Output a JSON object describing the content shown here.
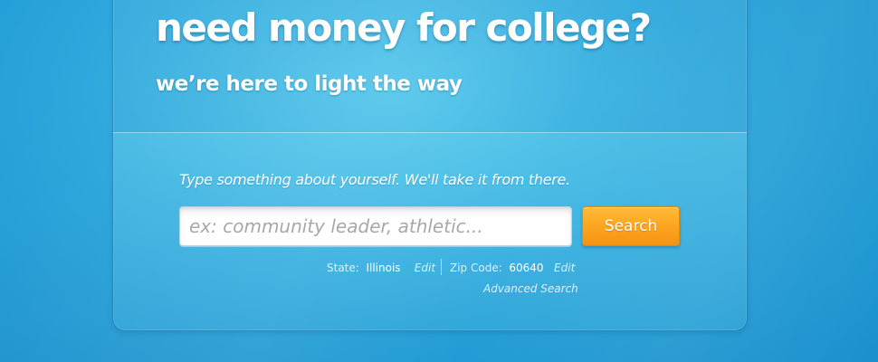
{
  "hero": {
    "headline": "need money for college?",
    "subheadline": "we’re here to light the way"
  },
  "search": {
    "prompt": "Type something about yourself. We'll take it from there.",
    "placeholder": "ex: community leader, athletic...",
    "button_label": "Search",
    "advanced_link": "Advanced Search"
  },
  "location": {
    "state_label": "State:",
    "state_value": "Illinois",
    "state_edit": "Edit",
    "zip_label": "Zip Code:",
    "zip_value": "60640",
    "zip_edit": "Edit"
  },
  "colors": {
    "background": "#2aa6dc",
    "button": "#fca520",
    "text": "#ffffff"
  }
}
